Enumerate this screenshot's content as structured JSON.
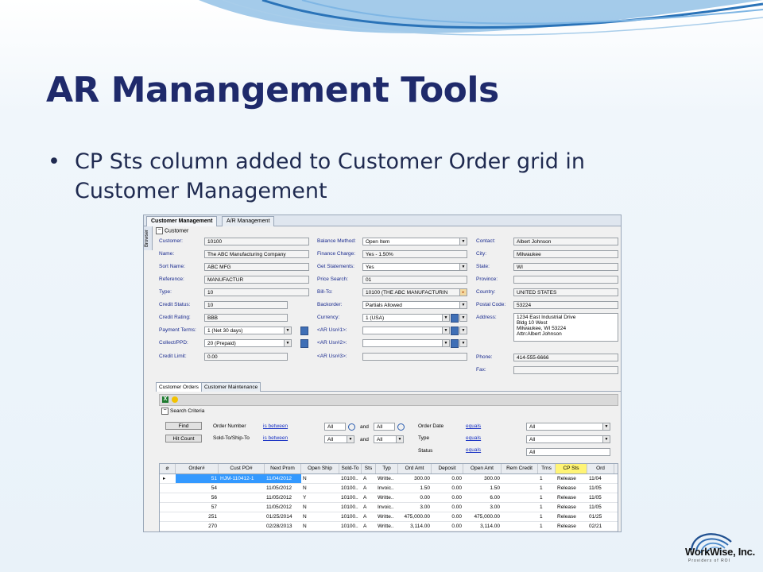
{
  "slide": {
    "title": "AR Manangement Tools",
    "bullet": "CP Sts column added to Customer Order grid in Customer Management",
    "bullet_symbol": "•"
  },
  "logo": {
    "name": "WorkWise, Inc.",
    "tagline": "Providers of ROI"
  },
  "app": {
    "tabs": [
      "Customer Management",
      "A/R Management"
    ],
    "side_tab": "Browser",
    "panel": "Customer",
    "fields": {
      "customer_lbl": "Customer:",
      "customer": "10100",
      "name_lbl": "Name:",
      "name": "The ABC Manufacturing Company",
      "sort_lbl": "Sort Name:",
      "sort": "ABC MFG",
      "reference_lbl": "Reference:",
      "reference": "MANUFACTUR",
      "type_lbl": "Type:",
      "type": "10",
      "credit_status_lbl": "Credit Status:",
      "credit_status": "10",
      "credit_rating_lbl": "Credit Rating:",
      "credit_rating": "BBB",
      "payment_terms_lbl": "Payment Terms:",
      "payment_terms": "1 (Net 30 days)",
      "collect_lbl": "Collect/PPD:",
      "collect": "20 (Prepaid)",
      "credit_limit_lbl": "Credit Limit:",
      "credit_limit": "0.00",
      "balance_method_lbl": "Balance Method:",
      "balance_method": "Open Item",
      "finance_charge_lbl": "Finance Charge:",
      "finance_charge": "Yes - 1.50%",
      "get_statements_lbl": "Get Statements:",
      "get_statements": "Yes",
      "price_search_lbl": "Price Search:",
      "price_search": "01",
      "bill_to_lbl": "Bill-To:",
      "bill_to": "10100 (THE ABC MANUFACTURIN",
      "backorder_lbl": "Backorder:",
      "backorder": "Partials Allowed",
      "currency_lbl": "Currency:",
      "currency": "1 (USA)",
      "ar_usr1_lbl": "<AR Usr#1>:",
      "ar_usr2_lbl": "<AR Usr#2>:",
      "ar_usr3_lbl": "<AR Usr#3>:",
      "contact_lbl": "Contact:",
      "contact": "Albert Johnson",
      "city_lbl": "City:",
      "city": "Milwaukee",
      "state_lbl": "State:",
      "state": "WI",
      "province_lbl": "Province:",
      "country_lbl": "Country:",
      "country": "UNITED STATES",
      "postal_lbl": "Postal Code:",
      "postal": "53224",
      "address_lbl": "Address:",
      "address": [
        "1234 East Industrial Drive",
        "Bldg 10 West",
        "Milwaukee, WI 53224",
        "Attn:Albert Johnson"
      ],
      "phone_lbl": "Phone:",
      "phone": "414-555-6666",
      "fax_lbl": "Fax:"
    },
    "subtabs": [
      "Customer Orders",
      "Customer Maintenance"
    ],
    "search": {
      "header": "Search Criteria",
      "find": "Find",
      "hit_count": "Hit Count",
      "order_number_lbl": "Order Number",
      "soldto_lbl": "Sold-To/Ship-To",
      "is_between": "is between",
      "and": "and",
      "all": "All",
      "order_date_lbl": "Order Date",
      "type_lbl": "Type",
      "status_lbl": "Status",
      "equals": "equals"
    },
    "grid": {
      "headers": [
        "Order#",
        "Cust PO#",
        "Next Prom",
        "Open Ship",
        "Sold-To",
        "Sts",
        "Typ",
        "Ord Amt",
        "Deposit",
        "Open Amt",
        "Rem Credit",
        "Trns",
        "CP Sts",
        "Ord"
      ],
      "rows": [
        [
          "51",
          "HJM-110412-1",
          "11/04/2012",
          "N",
          "10100..",
          "A",
          "Writte..",
          "300.00",
          "0.00",
          "300.00",
          "",
          "1",
          "Release",
          "11/04"
        ],
        [
          "54",
          "",
          "11/05/2012",
          "N",
          "10100..",
          "A",
          "Invoic..",
          "1.50",
          "0.00",
          "1.50",
          "",
          "1",
          "Release",
          "11/05"
        ],
        [
          "56",
          "",
          "11/05/2012",
          "Y",
          "10100..",
          "A",
          "Writte..",
          "0.00",
          "0.00",
          "6.00",
          "",
          "1",
          "Release",
          "11/05"
        ],
        [
          "57",
          "",
          "11/05/2012",
          "N",
          "10100..",
          "A",
          "Invoic..",
          "3.00",
          "0.00",
          "3.00",
          "",
          "1",
          "Release",
          "11/05"
        ],
        [
          "251",
          "",
          "01/25/2014",
          "N",
          "10100..",
          "A",
          "Writte..",
          "475,000.00",
          "0.00",
          "475,000.00",
          "",
          "1",
          "Release",
          "01/25"
        ],
        [
          "270",
          "",
          "02/28/2013",
          "N",
          "10100..",
          "A",
          "Writte..",
          "3,114.00",
          "0.00",
          "3,114.00",
          "",
          "1",
          "Release",
          "02/21"
        ]
      ]
    }
  },
  "colors": {
    "title": "#1f2a6b",
    "highlight": "#fff475",
    "selection": "#3399ff",
    "label": "#1a2b8f"
  }
}
